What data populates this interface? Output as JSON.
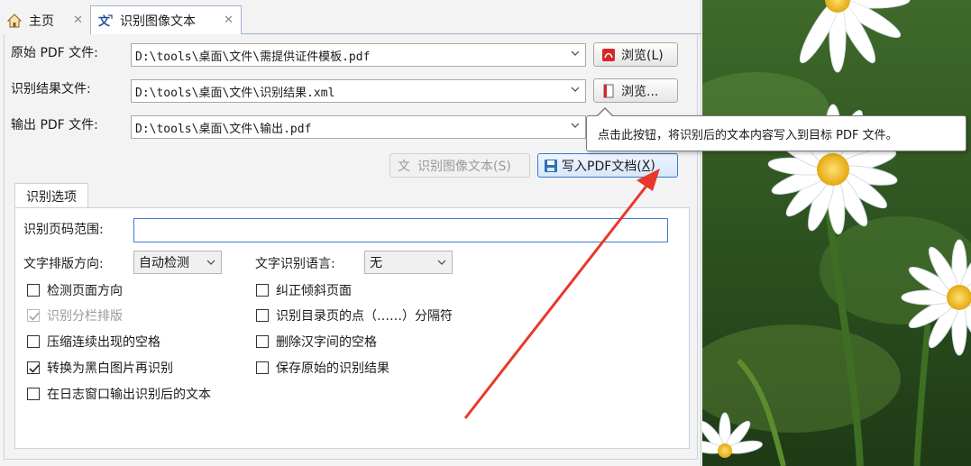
{
  "tabs": [
    {
      "label": "主页",
      "icon": "home-icon"
    },
    {
      "label": "识别图像文本",
      "icon": "ocr-text-icon"
    }
  ],
  "form": {
    "source_pdf": {
      "label": "原始 PDF 文件:",
      "value": "D:\\tools\\桌面\\文件\\需提供证件模板.pdf"
    },
    "result_file": {
      "label": "识别结果文件:",
      "value": "D:\\tools\\桌面\\文件\\识别结果.xml"
    },
    "output_pdf": {
      "label": "输出 PDF 文件:",
      "value": "D:\\tools\\桌面\\文件\\输出.pdf"
    }
  },
  "buttons": {
    "browse_pdf": "浏览(L)",
    "browse_result": "浏览...",
    "recognize": "识别图像文本(S)",
    "write_pdf_prefix": "写入",
    "write_pdf_mid": "PDF文档(",
    "write_pdf_key": "X",
    "write_pdf_suffix": ")"
  },
  "tooltip": "点击此按钮，将识别后的文本内容写入到目标 PDF 文件。",
  "options": {
    "section_title": "识别选项",
    "page_range_label": "识别页码范围:",
    "page_range_value": "",
    "layout_dir_label": "文字排版方向:",
    "layout_dir_value": "自动检测",
    "lang_label": "文字识别语言:",
    "lang_value": "无",
    "checks_left": [
      {
        "label": "检测页面方向",
        "checked": false,
        "disabled": false
      },
      {
        "label": "识别分栏排版",
        "checked": true,
        "disabled": true
      },
      {
        "label": "压缩连续出现的空格",
        "checked": false,
        "disabled": false
      },
      {
        "label": "转换为黑白图片再识别",
        "checked": true,
        "disabled": false
      },
      {
        "label": "在日志窗口输出识别后的文本",
        "checked": false,
        "disabled": false
      }
    ],
    "checks_right": [
      {
        "label": "纠正倾斜页面",
        "checked": false,
        "disabled": false
      },
      {
        "label": "识别目录页的点（……）分隔符",
        "checked": false,
        "disabled": false
      },
      {
        "label": "删除汉字间的空格",
        "checked": false,
        "disabled": false
      },
      {
        "label": "保存原始的识别结果",
        "checked": false,
        "disabled": false
      }
    ]
  },
  "colors": {
    "accent_border": "#3b7bc8",
    "annotation_arrow": "#e8382b",
    "pdf_icon_red": "#d8262a"
  }
}
